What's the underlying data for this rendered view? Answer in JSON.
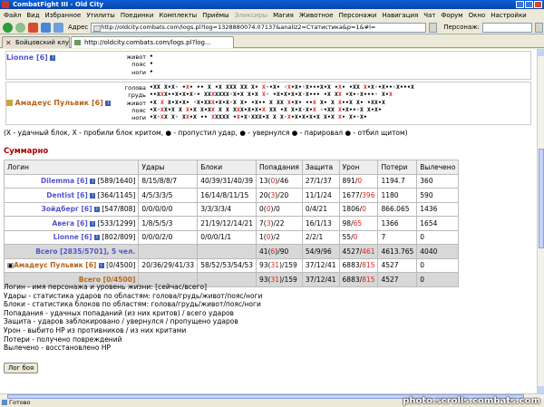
{
  "window": {
    "title": "CombatFight III - Old City"
  },
  "menu": [
    "Файл",
    "Вид",
    "Избранное",
    "Утилиты",
    "Поединки",
    "Комплекты",
    "Приёмы",
    "Эликсиры",
    "Магия",
    "Животное",
    "Персонажи",
    "Навигация",
    "Чат",
    "Форум",
    "Окно",
    "Настройки"
  ],
  "menu_dim": [
    "Эликсиры"
  ],
  "toolbar": {
    "address_label": "Адрес",
    "address": "http://oldcity.combats.com/logs.pl?log=1328880074.07137&analiz2=Статистика&p=1&#l=",
    "person_label": "Персонаж:"
  },
  "tabs": [
    {
      "label": "Бойцовский клуб",
      "active": false
    },
    {
      "label": "http://oldcity.combats.com/logs.pl?log...",
      "active": true
    }
  ],
  "fight": {
    "fighter1": {
      "name": "Lionne [6]",
      "zones": [
        "живот",
        "пояс",
        "ноги"
      ],
      "marks": [
        "•",
        "•",
        "•"
      ]
    },
    "fighter2": {
      "name": "Амадеус Пульвик [6]",
      "zones": [
        "голова",
        "грудь",
        "живот",
        "пояс",
        "ноги"
      ],
      "marks": [
        "•XX X•X• •X• •• X •X XXX XX X• X••X• •X•X••X•••X•X •X• •XX X•X••X•••X•••X",
        "••XXX••X•X•X•• XXXXXXX•X•X X•X X• •X•X•X•X•X••• •X XX •X••X•••• X•X",
        "•X X X•X•X• •X•XXX•X•X•X X• •X•• X XX X•X• ••X X• X X••X X• •XX•X",
        "•X•XX•X X X•X X•XX X X XXX•X•X•X XX •X X•X•X•X ••XX X•X•••X X•X•",
        "•X•XX X• XX•X •• XXXXX •X•X•XXX•X X X•X•X•X•X•X X•X X• X••X•"
      ]
    }
  },
  "legend": "(X - удачный блок, X - пробили блок критом, ● - пропустил удар, ● - увернулся ● - парировал ● - отбил щитом)",
  "summary": {
    "title": "Суммарно",
    "headers": [
      "Логин",
      "Удары",
      "Блоки",
      "Попадания",
      "Защита",
      "Урон",
      "Потери",
      "Вылечено"
    ],
    "rows": [
      {
        "login": "Dilemma [6]",
        "hp": "[589/1640]",
        "hits": "8/15/8/8/7",
        "blocks": "40/39/31/40/39",
        "landed": "13",
        "landed_crit": "0",
        "landed_total": "46",
        "defense": "27/1/37",
        "dmg": "891",
        "dmg_crit": "0",
        "loss": "1194.7",
        "healed": "360"
      },
      {
        "login": "Dentist [6]",
        "hp": "[364/1145]",
        "hits": "4/5/3/3/5",
        "blocks": "16/14/8/11/15",
        "landed": "20",
        "landed_crit": "3",
        "landed_total": "20",
        "defense": "11/1/24",
        "dmg": "1677",
        "dmg_crit": "396",
        "loss": "1180",
        "healed": "590"
      },
      {
        "login": "Зойдберг [6]",
        "hp": "[547/808]",
        "hits": "0/0/0/0/0",
        "blocks": "3/3/3/3/4",
        "landed": "0",
        "landed_crit": "0",
        "landed_total": "0",
        "defense": "0/4/21",
        "dmg": "1806",
        "dmg_crit": "0",
        "loss": "866.065",
        "healed": "1436"
      },
      {
        "login": "Авега [6]",
        "hp": "[533/1299]",
        "hits": "1/8/5/5/3",
        "blocks": "21/19/12/14/21",
        "landed": "7",
        "landed_crit": "3",
        "landed_total": "22",
        "defense": "16/1/13",
        "dmg": "98",
        "dmg_crit": "65",
        "loss": "1366",
        "healed": "1654"
      },
      {
        "login": "Lionne [6]",
        "hp": "[802/809]",
        "hits": "0/0/0/2/0",
        "blocks": "0/0/0/1/1",
        "landed": "1",
        "landed_crit": "0",
        "landed_total": "2",
        "defense": "2/2/1",
        "dmg": "55",
        "dmg_crit": "0",
        "loss": "7",
        "healed": "0"
      }
    ],
    "total1": {
      "login": "Всего [2835/5701], 5 чел.",
      "landed": "41",
      "landed_crit": "6",
      "landed_total": "90",
      "defense": "54/9/96",
      "dmg": "4527",
      "dmg_crit": "461",
      "loss": "4613.765",
      "healed": "4040"
    },
    "row_amadeus": {
      "login": "Амадеус Пульвик [6]",
      "hp": "[0/4500]",
      "hits": "20/36/29/41/33",
      "blocks": "58/52/53/54/53",
      "landed": "93",
      "landed_crit": "31",
      "landed_total": "159",
      "defense": "37/12/41",
      "dmg": "6883",
      "dmg_crit": "815",
      "loss": "4527",
      "healed": "0"
    },
    "total2": {
      "login": "Всего [0/4500]",
      "landed": "93",
      "landed_crit": "31",
      "landed_total": "159",
      "defense": "37/12/41",
      "dmg": "6883",
      "dmg_crit": "815",
      "loss": "4527",
      "healed": "0"
    }
  },
  "notes": [
    "Логин - имя персонажа и уровень жизни: [сейчас/всего]",
    "Удары - статистика ударов по областям: голова/грудь/живот/пояс/ноги",
    "Блоки - статистика блоков по областям: голова/грудь/живот/пояс/ноги",
    "Попадания - удачных попаданий (из них критов) / всего ударов",
    "Защита - ударов заблокировано / увернулся / пропущено ударов",
    "Урон - выбито HP из противников / из них критами",
    "Потери - получено повреждений",
    "Вылечено - восстановлено HP"
  ],
  "log_button": "Лог боя",
  "status": {
    "text": "Готово",
    "watermark": "photo.scrolls.combats.com"
  }
}
